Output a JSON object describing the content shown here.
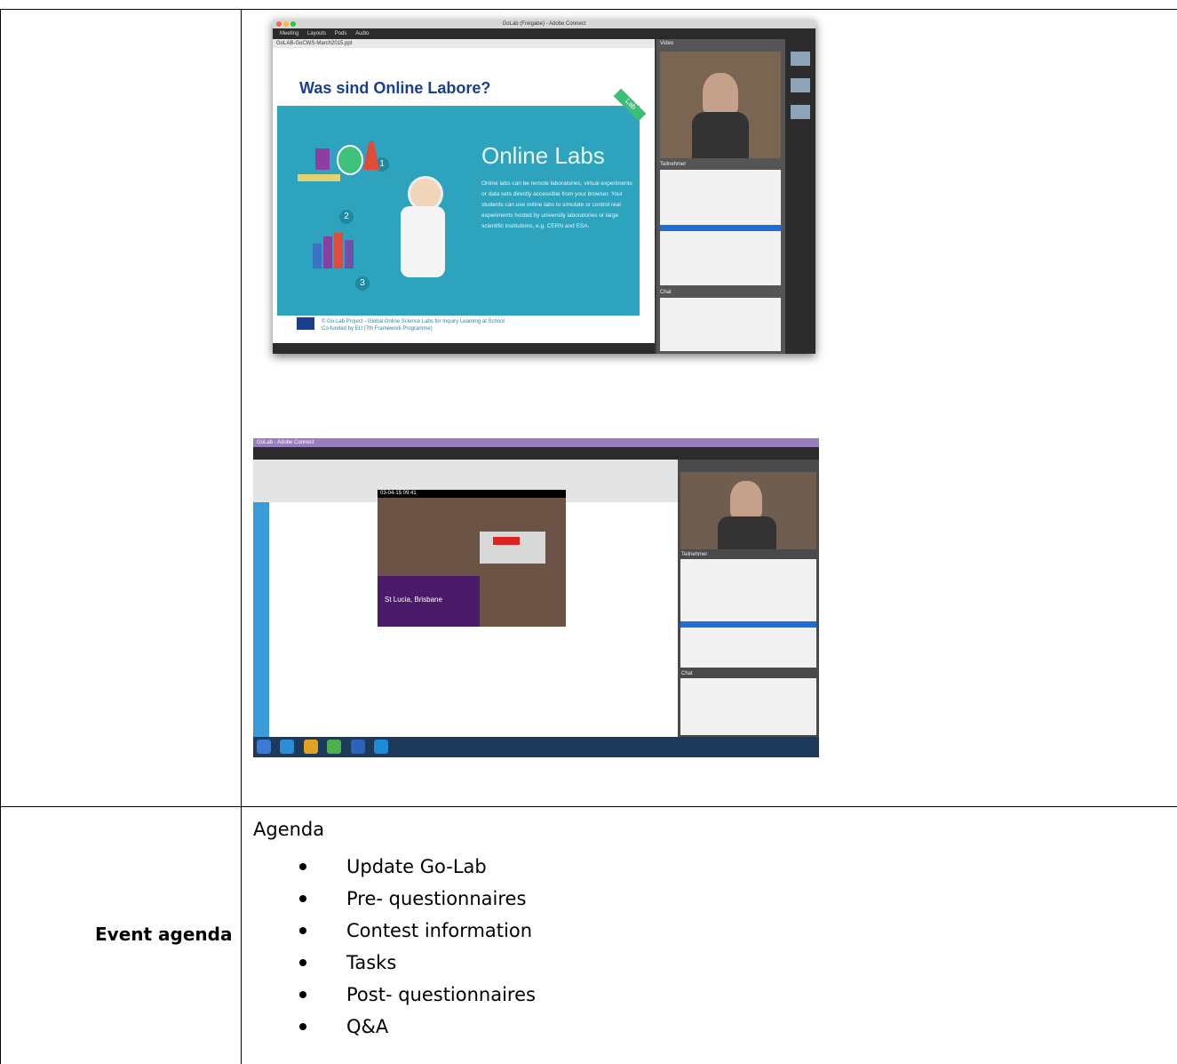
{
  "screenshot1": {
    "window_title": "GoLab (Freigabe) - Adobe Connect",
    "menu": [
      "Meeting",
      "Layouts",
      "Pods",
      "Audio"
    ],
    "file_name": "GoLAB-GoCWS-March2015.ppt",
    "slide_heading": "Was sind Online Labore?",
    "slide_band_title": "Online Labs",
    "slide_body": "Online labs can be remote laboratories, virtual experiments or data sets directly accessible from your browser. Your students can use online labs to simulate or control real experiments hosted by university laboratories or large scientific institutions, e.g. CERN and ESA.",
    "numbers": [
      "1",
      "2",
      "3"
    ],
    "lab_tag": "Lab",
    "footer_line1": "© Go-Lab Project - Global Online Science Labs for Inquiry Learning at School",
    "footer_line2": "Co-funded by EU (7th Framework Programme)",
    "side_video_label": "Video",
    "participants_label": "Teilnehmer",
    "chat_label": "Chat"
  },
  "screenshot2": {
    "window_title": "GoLab - Adobe Connect",
    "timestamp": "03-04-15 09:41",
    "sign_title": "St Lucia, Brisbane",
    "participants_label": "Teilnehmer",
    "chat_label": "Chat"
  },
  "agenda": {
    "title": "Agenda",
    "items": [
      "Update Go-Lab",
      "Pre- questionnaires",
      "Contest information",
      "Tasks",
      "Post- questionnaires",
      "Q&A"
    ]
  },
  "row_label": "Event agenda"
}
